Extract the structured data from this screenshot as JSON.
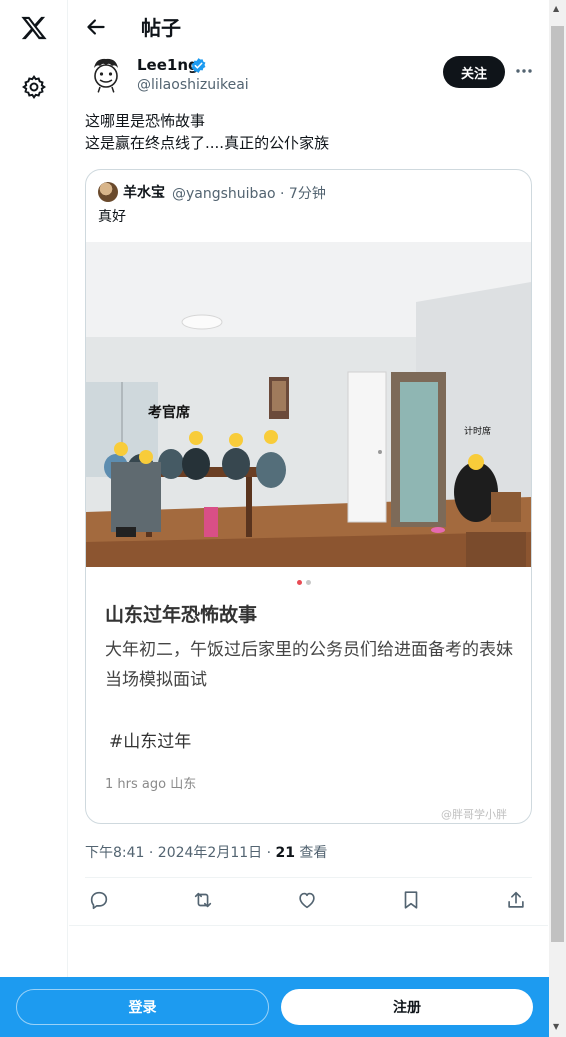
{
  "header": {
    "title": "帖子"
  },
  "post": {
    "author_name": "Lee1ng",
    "handle": "@lilaoshizuikeai",
    "follow_label": "关注",
    "text_lines": [
      "这哪里是恐怖故事",
      "这是赢在终点线了....真正的公仆家族"
    ],
    "timestamp": "下午8:41 · 2024年2月11日 · ",
    "views_count": "21",
    "views_label": " 查看"
  },
  "quote": {
    "name": "羊水宝",
    "meta": "@yangshuibao · 7分钟",
    "text": "真好",
    "image_labels": {
      "examiner": "考官席",
      "timer": "计时席"
    },
    "card_title": "山东过年恐怖故事",
    "card_body": "大年初二，午饭过后家里的公务员们给进面备考的表妹当场模拟面试",
    "card_tag": "#山东过年",
    "card_time": "1 hrs ago 山东",
    "watermark": "@胖哥学小胖"
  },
  "bottom": {
    "login_label": "登录",
    "signup_label": "注册"
  },
  "icons": [
    "x-logo-icon",
    "gear-icon",
    "back-arrow-icon",
    "verified-icon",
    "more-icon",
    "reply-icon",
    "retweet-icon",
    "like-icon",
    "bookmark-icon",
    "share-icon"
  ],
  "colors": {
    "accent": "#1d9bf0",
    "text": "#0f1419",
    "muted": "#536471",
    "border": "#cfd9de"
  }
}
